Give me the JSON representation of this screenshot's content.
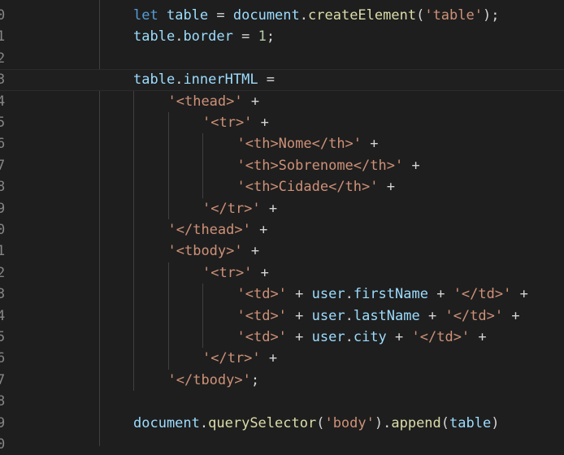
{
  "editor": {
    "line_numbers": [
      "0",
      "1",
      "2",
      "3",
      "4",
      "5",
      "6",
      "7",
      "8",
      "9",
      "0",
      "1",
      "2",
      "3",
      "4",
      "5",
      "6",
      "7",
      "8",
      "9",
      "0"
    ],
    "current_line_index": 3,
    "lines": [
      {
        "indent": 0,
        "tokens": [
          {
            "t": "let",
            "c": "kw"
          },
          {
            "t": " "
          },
          {
            "t": "table",
            "c": "var"
          },
          {
            "t": " = "
          },
          {
            "t": "document",
            "c": "var"
          },
          {
            "t": "."
          },
          {
            "t": "createElement",
            "c": "fn"
          },
          {
            "t": "("
          },
          {
            "t": "'table'",
            "c": "str"
          },
          {
            "t": ");"
          }
        ]
      },
      {
        "indent": 0,
        "tokens": [
          {
            "t": "table",
            "c": "var"
          },
          {
            "t": "."
          },
          {
            "t": "border",
            "c": "var"
          },
          {
            "t": " = "
          },
          {
            "t": "1",
            "c": "num"
          },
          {
            "t": ";"
          }
        ]
      },
      {
        "indent": 0,
        "tokens": []
      },
      {
        "indent": 0,
        "tokens": [
          {
            "t": "table",
            "c": "var"
          },
          {
            "t": "."
          },
          {
            "t": "innerHTML",
            "c": "var"
          },
          {
            "t": " ="
          }
        ]
      },
      {
        "indent": 1,
        "tokens": [
          {
            "t": "'<thead>'",
            "c": "str"
          },
          {
            "t": " +"
          }
        ]
      },
      {
        "indent": 2,
        "tokens": [
          {
            "t": "'<tr>'",
            "c": "str"
          },
          {
            "t": " +"
          }
        ]
      },
      {
        "indent": 3,
        "tokens": [
          {
            "t": "'<th>Nome</th>'",
            "c": "str"
          },
          {
            "t": " +"
          }
        ]
      },
      {
        "indent": 3,
        "tokens": [
          {
            "t": "'<th>Sobrenome</th>'",
            "c": "str"
          },
          {
            "t": " +"
          }
        ]
      },
      {
        "indent": 3,
        "tokens": [
          {
            "t": "'<th>Cidade</th>'",
            "c": "str"
          },
          {
            "t": " +"
          }
        ]
      },
      {
        "indent": 2,
        "tokens": [
          {
            "t": "'</tr>'",
            "c": "str"
          },
          {
            "t": " +"
          }
        ]
      },
      {
        "indent": 1,
        "tokens": [
          {
            "t": "'</thead>'",
            "c": "str"
          },
          {
            "t": " +"
          }
        ]
      },
      {
        "indent": 1,
        "tokens": [
          {
            "t": "'<tbody>'",
            "c": "str"
          },
          {
            "t": " +"
          }
        ]
      },
      {
        "indent": 2,
        "tokens": [
          {
            "t": "'<tr>'",
            "c": "str"
          },
          {
            "t": " +"
          }
        ]
      },
      {
        "indent": 3,
        "tokens": [
          {
            "t": "'<td>'",
            "c": "str"
          },
          {
            "t": " + "
          },
          {
            "t": "user",
            "c": "var"
          },
          {
            "t": "."
          },
          {
            "t": "firstName",
            "c": "var"
          },
          {
            "t": " + "
          },
          {
            "t": "'</td>'",
            "c": "str"
          },
          {
            "t": " +"
          }
        ]
      },
      {
        "indent": 3,
        "tokens": [
          {
            "t": "'<td>'",
            "c": "str"
          },
          {
            "t": " + "
          },
          {
            "t": "user",
            "c": "var"
          },
          {
            "t": "."
          },
          {
            "t": "lastName",
            "c": "var"
          },
          {
            "t": " + "
          },
          {
            "t": "'</td>'",
            "c": "str"
          },
          {
            "t": " +"
          }
        ]
      },
      {
        "indent": 3,
        "tokens": [
          {
            "t": "'<td>'",
            "c": "str"
          },
          {
            "t": " + "
          },
          {
            "t": "user",
            "c": "var"
          },
          {
            "t": "."
          },
          {
            "t": "city",
            "c": "var"
          },
          {
            "t": " + "
          },
          {
            "t": "'</td>'",
            "c": "str"
          },
          {
            "t": " +"
          }
        ]
      },
      {
        "indent": 2,
        "tokens": [
          {
            "t": "'</tr>'",
            "c": "str"
          },
          {
            "t": " +"
          }
        ]
      },
      {
        "indent": 1,
        "tokens": [
          {
            "t": "'</tbody>'",
            "c": "str"
          },
          {
            "t": ";"
          }
        ]
      },
      {
        "indent": 0,
        "tokens": []
      },
      {
        "indent": 0,
        "tokens": [
          {
            "t": "document",
            "c": "var"
          },
          {
            "t": "."
          },
          {
            "t": "querySelector",
            "c": "fn"
          },
          {
            "t": "("
          },
          {
            "t": "'body'",
            "c": "str"
          },
          {
            "t": ")."
          },
          {
            "t": "append",
            "c": "fn"
          },
          {
            "t": "("
          },
          {
            "t": "table",
            "c": "var"
          },
          {
            "t": ")"
          }
        ]
      },
      {
        "indent": 0,
        "tokens": []
      }
    ]
  }
}
